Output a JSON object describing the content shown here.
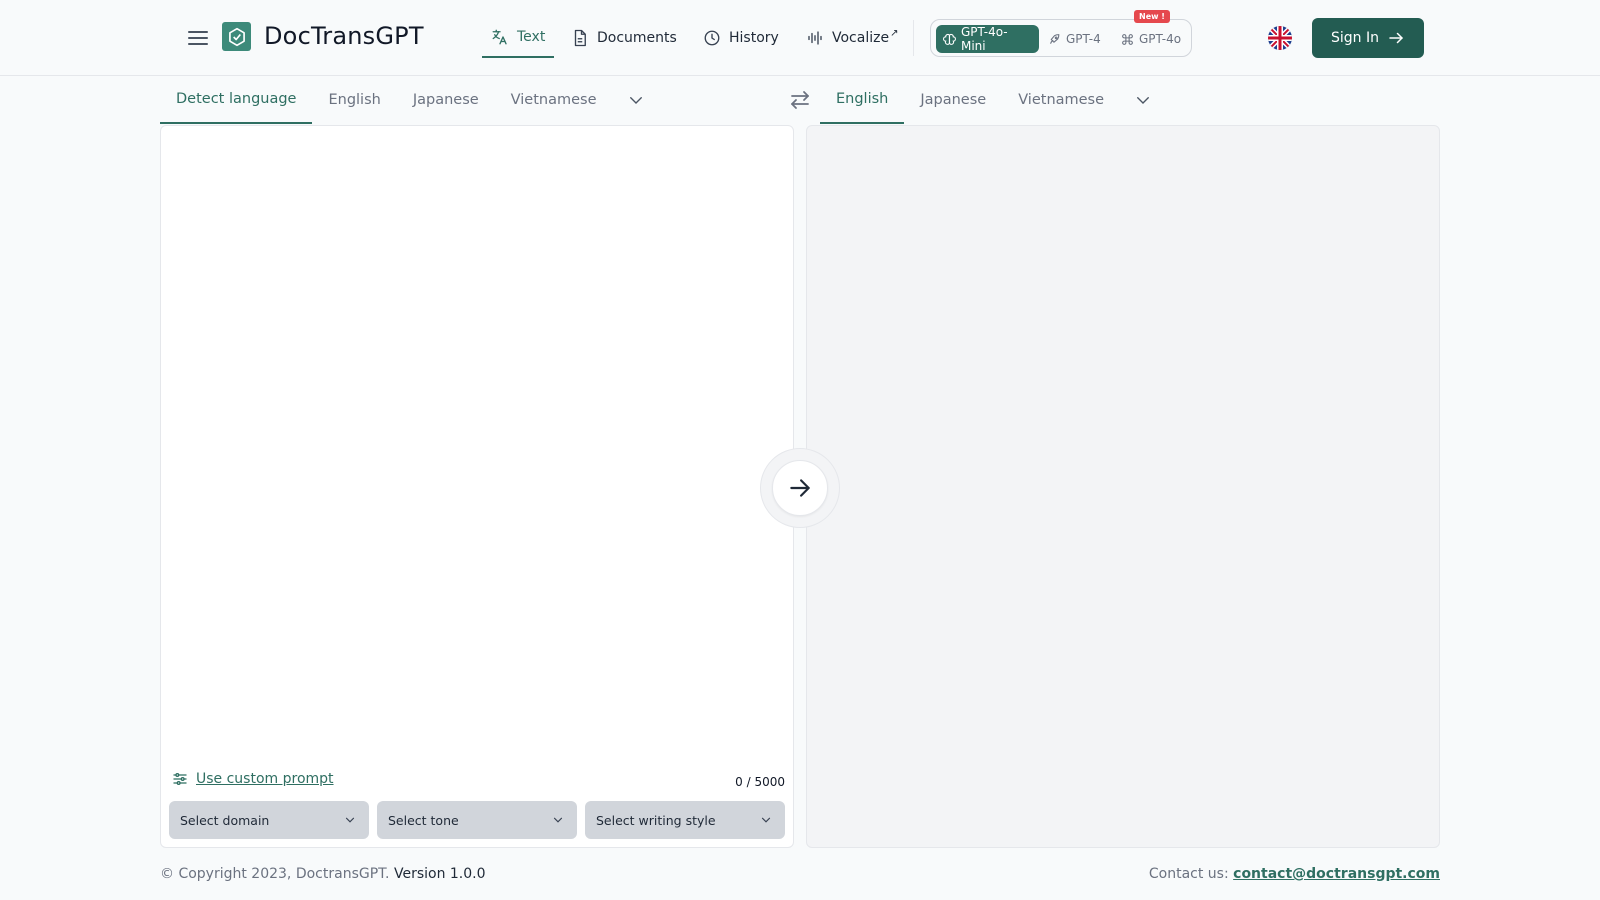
{
  "header": {
    "brand": "DocTransGPT",
    "nav": [
      {
        "label": "Text",
        "icon": "translate-icon"
      },
      {
        "label": "Documents",
        "icon": "document-icon"
      },
      {
        "label": "History",
        "icon": "clock-icon"
      },
      {
        "label": "Vocalize",
        "icon": "waveform-icon"
      }
    ],
    "vocalize_external": "↗",
    "models": [
      {
        "label": "GPT-4o-Mini",
        "icon": "brain-icon",
        "selected": true
      },
      {
        "label": "GPT-4",
        "icon": "rocket-icon",
        "selected": false
      },
      {
        "label": "GPT-4o",
        "icon": "command-icon",
        "selected": false
      }
    ],
    "new_badge": "New !",
    "signin_label": "Sign In"
  },
  "source_languages": [
    "Detect language",
    "English",
    "Japanese",
    "Vietnamese"
  ],
  "source_active": "Detect language",
  "target_languages": [
    "English",
    "Japanese",
    "Vietnamese"
  ],
  "target_active": "English",
  "editor": {
    "source_text": "",
    "custom_prompt_label": "Use custom prompt",
    "counter": "0 / 5000",
    "selects": [
      {
        "label": "Select domain"
      },
      {
        "label": "Select tone"
      },
      {
        "label": "Select writing style"
      }
    ]
  },
  "footer": {
    "copyright": "© Copyright 2023, DoctransGPT.",
    "version": "Version 1.0.0",
    "contact_label": "Contact us:",
    "contact_email": "contact@doctransgpt.com"
  },
  "colors": {
    "accent": "#2f6f62",
    "signin_bg": "#235c52",
    "new_badge": "#e5484d",
    "page_bg": "#f8fafb"
  }
}
